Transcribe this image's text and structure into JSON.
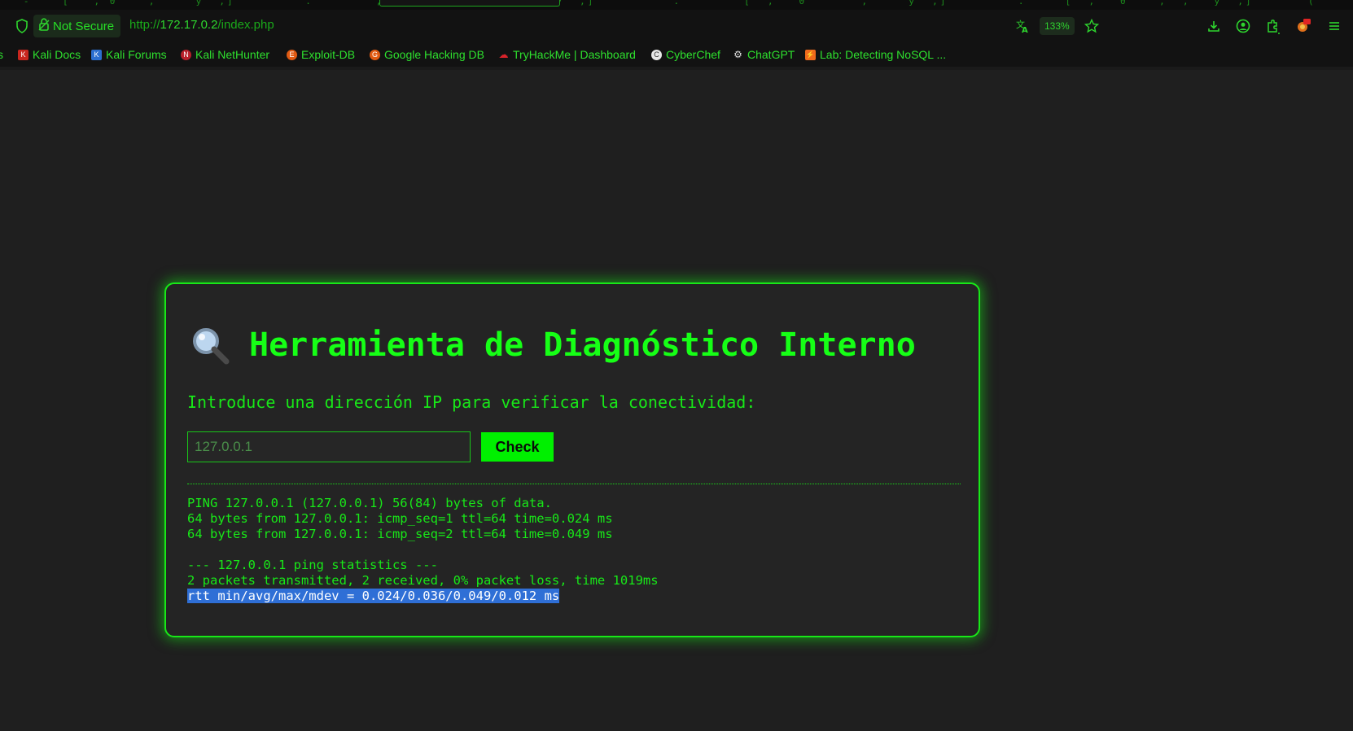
{
  "browser": {
    "security_label": "Not Secure",
    "url_scheme": "http://",
    "url_host": "172.17.0.2",
    "url_path": "/index.php",
    "zoom": "133%",
    "bookmarks": [
      {
        "label": "s",
        "icon": ""
      },
      {
        "label": "Kali Docs",
        "icon": "kali-docs-icon"
      },
      {
        "label": "Kali Forums",
        "icon": "kali-forums-icon"
      },
      {
        "label": "Kali NetHunter",
        "icon": "kali-nethunter-icon"
      },
      {
        "label": "Exploit-DB",
        "icon": "exploit-db-icon"
      },
      {
        "label": "Google Hacking DB",
        "icon": "ghdb-icon"
      },
      {
        "label": "TryHackMe | Dashboard",
        "icon": "tryhackme-icon"
      },
      {
        "label": "CyberChef",
        "icon": "cyberchef-icon"
      },
      {
        "label": "ChatGPT",
        "icon": "chatgpt-icon"
      },
      {
        "label": "Lab: Detecting NoSQL ...",
        "icon": "portswigger-icon"
      }
    ]
  },
  "page": {
    "title_icon": "magnifying-glass-icon",
    "title": "Herramienta de Diagnóstico Interno",
    "instruction": "Introduce una dirección IP para verificar la conectividad:",
    "input_placeholder": "127.0.0.1",
    "check_label": "Check",
    "output_lines": [
      "PING 127.0.0.1 (127.0.0.1) 56(84) bytes of data.",
      "64 bytes from 127.0.0.1: icmp_seq=1 ttl=64 time=0.024 ms",
      "64 bytes from 127.0.0.1: icmp_seq=2 ttl=64 time=0.049 ms",
      "",
      "--- 127.0.0.1 ping statistics ---",
      "2 packets transmitted, 2 received, 0% packet loss, time 1019ms"
    ],
    "output_selected_line": "rtt min/avg/max/mdev = 0.024/0.036/0.049/0.012 ms"
  },
  "colors": {
    "accent": "#16ff16",
    "background": "#1f1f1f",
    "card": "#242424",
    "selection": "#2f6fd6"
  }
}
